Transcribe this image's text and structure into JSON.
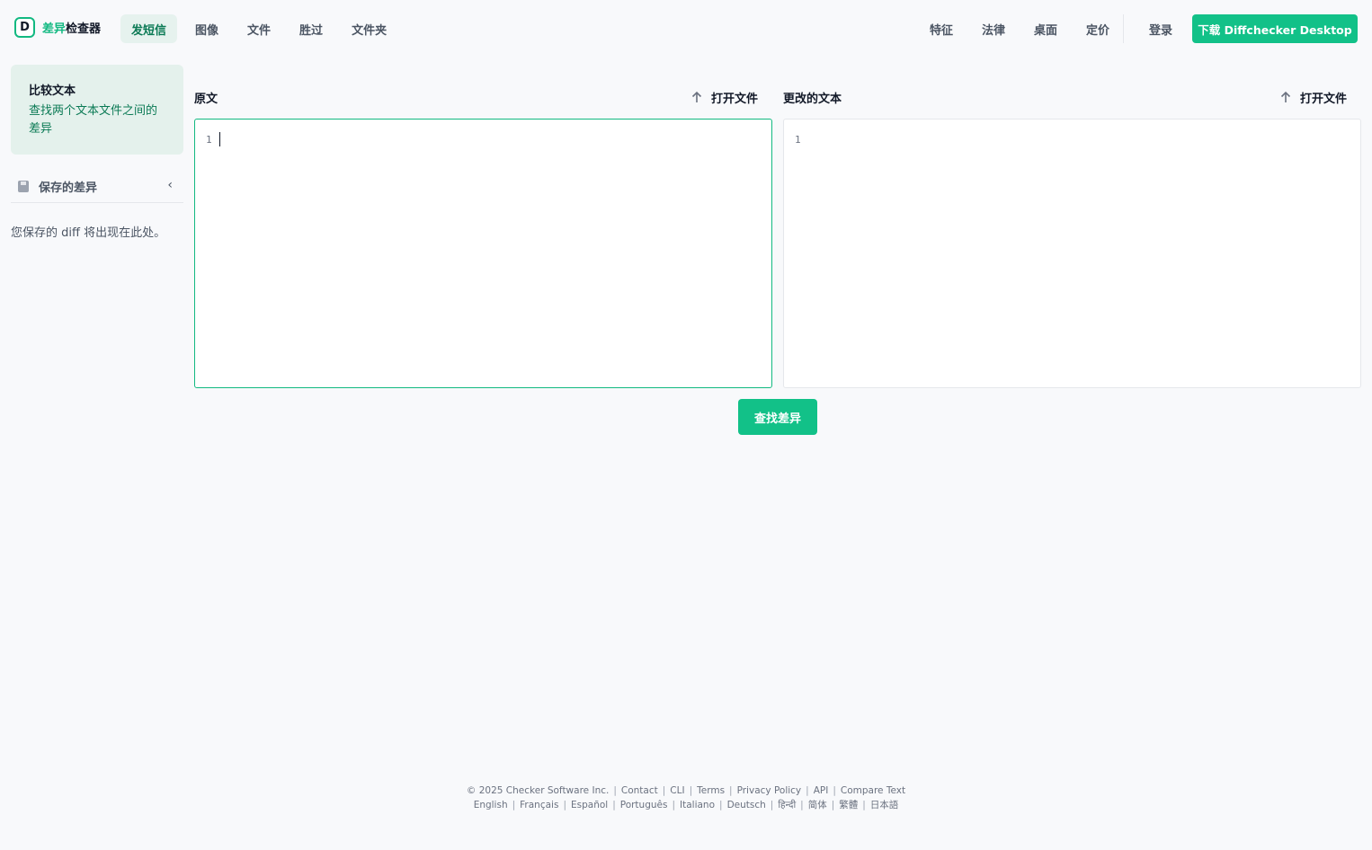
{
  "brand": {
    "name_accent": "差异",
    "name_rest": "检查器",
    "icon": "D"
  },
  "nav_left": [
    "发短信",
    "图像",
    "文件",
    "胜过",
    "文件夹"
  ],
  "nav_right": [
    "特征",
    "法律",
    "桌面",
    "定价"
  ],
  "login": "登录",
  "download": "下载 Diffchecker Desktop",
  "sidebar": {
    "card_title": "比较文本",
    "card_desc": "查找两个文本文件之间的差异",
    "saved_label": "保存的差异",
    "saved_empty": "您保存的 diff 将出现在此处。"
  },
  "left_pane": {
    "label": "原文",
    "open": "打开文件",
    "line": "1"
  },
  "right_pane": {
    "label": "更改的文本",
    "open": "打开文件",
    "line": "1"
  },
  "find_button": "查找差异",
  "footer": {
    "row1": [
      "© 2025 Checker Software Inc.",
      "Contact",
      "CLI",
      "Terms",
      "Privacy Policy",
      "API",
      "Compare Text"
    ],
    "row2": [
      "English",
      "Français",
      "Español",
      "Português",
      "Italiano",
      "Deutsch",
      "हिन्दी",
      "简体",
      "繁體",
      "日本語"
    ]
  },
  "colors": {
    "accent": "#12c188",
    "accent_dark": "#0b7a55",
    "background": "#f8f9fb"
  }
}
